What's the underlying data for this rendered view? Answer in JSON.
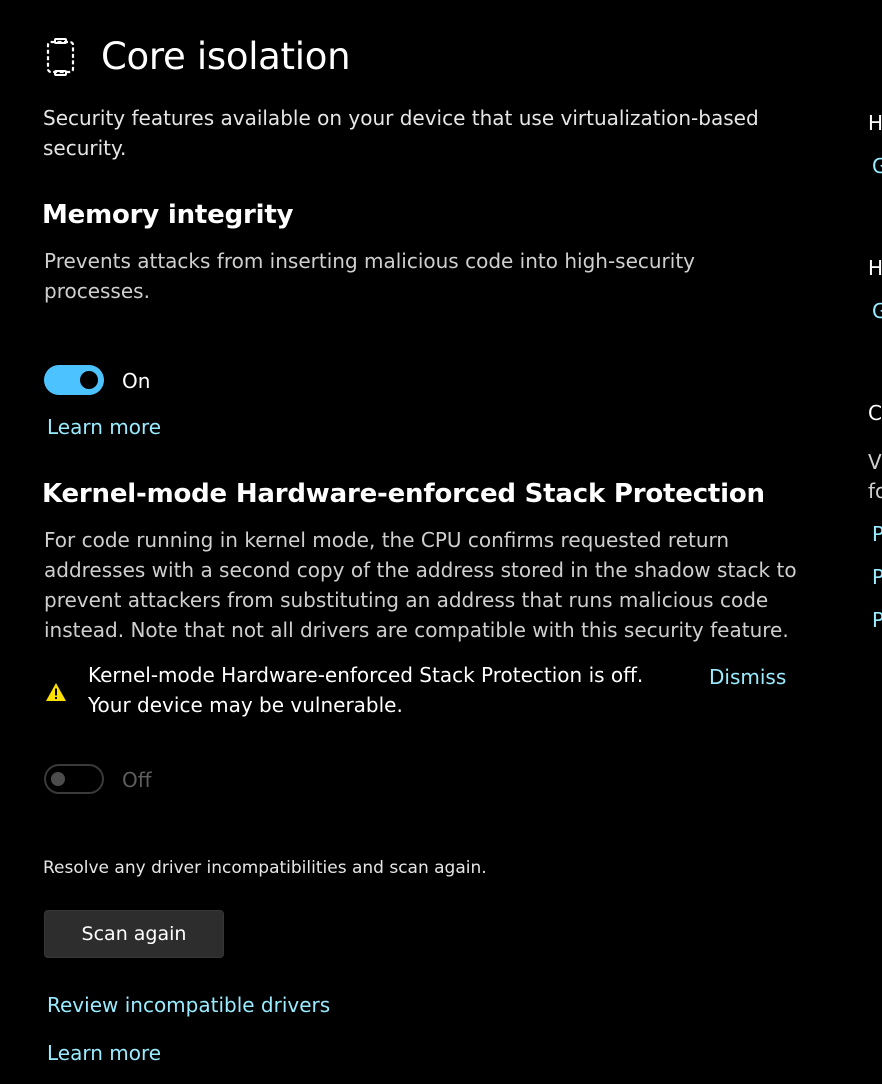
{
  "page": {
    "title": "Core isolation",
    "subtitle": "Security features available on your device that use virtualization-based security."
  },
  "memory_integrity": {
    "title": "Memory integrity",
    "description": "Prevents attacks from inserting malicious code into high-security processes.",
    "toggle_state": "On",
    "learn_more": "Learn more"
  },
  "stack_protection": {
    "title": "Kernel-mode Hardware-enforced Stack Protection",
    "description": "For code running in kernel mode, the CPU confirms requested return addresses with a second copy of the address stored in the shadow stack to prevent attackers from substituting an address that runs malicious code instead. Note that not all drivers are compatible with this security feature.",
    "warning_text": "Kernel-mode Hardware-enforced Stack Protection is off. Your device may be vulnerable.",
    "dismiss": "Dismiss",
    "toggle_state": "Off",
    "resolve_text": "Resolve any driver incompatibilities and scan again.",
    "scan_button": "Scan again",
    "review_link": "Review incompatible drivers",
    "learn_more": "Learn more"
  },
  "right_column": {
    "items": [
      "H",
      "G",
      "H",
      "G",
      "C",
      "V",
      "fo",
      "P",
      "P",
      "P"
    ]
  },
  "colors": {
    "background": "#000000",
    "accent": "#4cc2ff",
    "link": "#99ebff",
    "warning": "#fce100"
  },
  "icons": {
    "header": "core-isolation-chip-icon",
    "warning": "warning-icon"
  }
}
